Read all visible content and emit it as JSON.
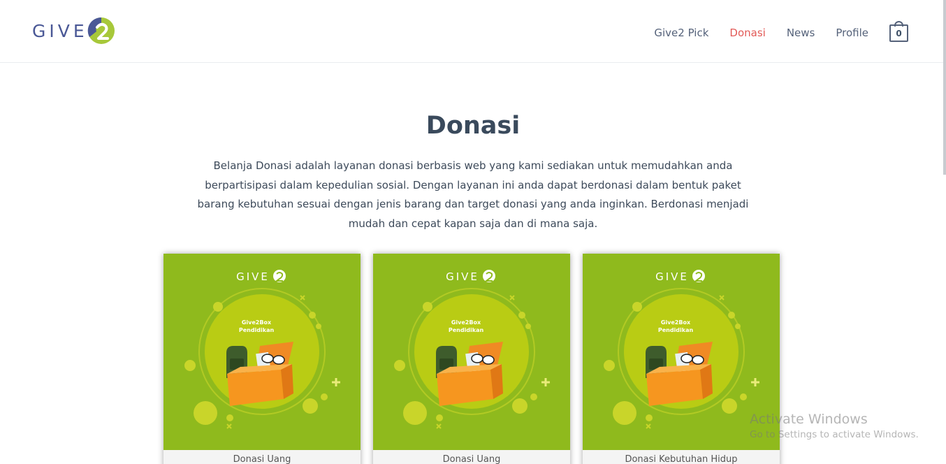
{
  "header": {
    "logo_text": "GIVE",
    "nav": [
      {
        "label": "Give2 Pick",
        "active": false
      },
      {
        "label": "Donasi",
        "active": true
      },
      {
        "label": "News",
        "active": false
      },
      {
        "label": "Profile",
        "active": false
      }
    ],
    "cart_count": "0"
  },
  "main": {
    "title": "Donasi",
    "intro": "Belanja Donasi adalah layanan donasi berbasis web yang kami sediakan untuk memudahkan anda berpartisipasi dalam kepedulian sosial. Dengan layanan ini anda dapat berdonasi dalam bentuk paket barang kebutuhan sesuai dengan jenis barang dan target donasi yang anda inginkan. Berdonasi menjadi mudah dan cepat kapan saja dan di mana saja."
  },
  "cards": [
    {
      "image_logo": "GIVE",
      "image_title": "Give2Box",
      "image_subtitle": "Pendidikan",
      "label": "Donasi Uang"
    },
    {
      "image_logo": "GIVE",
      "image_title": "Give2Box",
      "image_subtitle": "Pendidikan",
      "label": "Donasi Uang"
    },
    {
      "image_logo": "GIVE",
      "image_title": "Give2Box",
      "image_subtitle": "Pendidikan",
      "label": "Donasi Kebutuhan Hidup"
    }
  ],
  "watermark": {
    "title": "Activate Windows",
    "subtitle": "Go to Settings to activate Windows."
  },
  "colors": {
    "brand_blue": "#4a5896",
    "brand_green": "#a7c83a",
    "nav_active": "#e25a57",
    "card_bg": "#8fba1d"
  }
}
